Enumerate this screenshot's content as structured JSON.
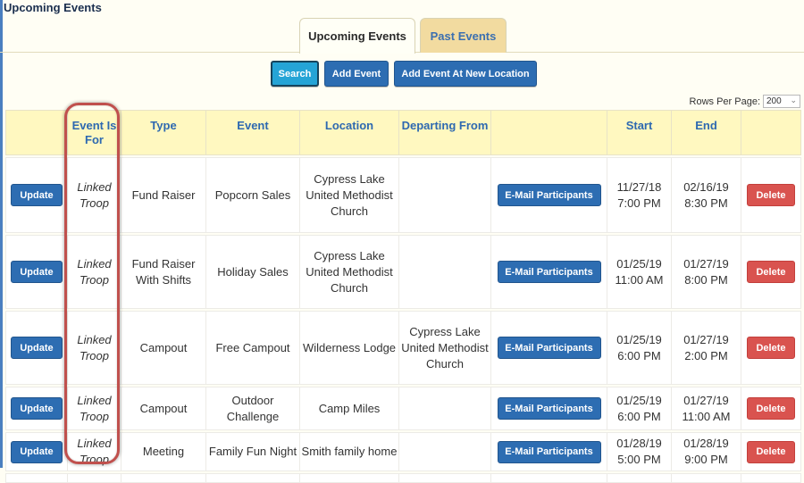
{
  "page": {
    "title": "Upcoming Events"
  },
  "tabs": [
    {
      "label": "Upcoming Events",
      "active": true
    },
    {
      "label": "Past Events",
      "active": false
    }
  ],
  "toolbar": {
    "search_label": "Search",
    "add_event_label": "Add Event",
    "add_event_new_location_label": "Add Event At New Location"
  },
  "rows_per_page": {
    "label": "Rows Per Page:",
    "value": "200"
  },
  "table": {
    "headers": [
      "",
      "Event Is For",
      "Type",
      "Event",
      "Location",
      "Departing From",
      "",
      "Start",
      "End",
      ""
    ],
    "rows": [
      {
        "update": "Update",
        "event_is_for": "Linked Troop",
        "type": "Fund Raiser",
        "event": "Popcorn Sales",
        "location": "Cypress Lake United Methodist Church",
        "departing_from": "",
        "email": "E-Mail Participants",
        "start_date": "11/27/18",
        "start_time": "7:00 PM",
        "end_date": "02/16/19",
        "end_time": "8:30 PM",
        "delete": "Delete"
      },
      {
        "update": "Update",
        "event_is_for": "Linked Troop",
        "type": "Fund Raiser With Shifts",
        "event": "Holiday Sales",
        "location": "Cypress Lake United Methodist Church",
        "departing_from": "",
        "email": "E-Mail Participants",
        "start_date": "01/25/19",
        "start_time": "11:00 AM",
        "end_date": "01/27/19",
        "end_time": "8:00 PM",
        "delete": "Delete"
      },
      {
        "update": "Update",
        "event_is_for": "Linked Troop",
        "type": "Campout",
        "event": "Free Campout",
        "location": "Wilderness Lodge",
        "departing_from": "Cypress Lake United Methodist Church",
        "email": "E-Mail Participants",
        "start_date": "01/25/19",
        "start_time": "6:00 PM",
        "end_date": "01/27/19",
        "end_time": "2:00 PM",
        "delete": "Delete"
      },
      {
        "update": "Update",
        "event_is_for": "Linked Troop",
        "type": "Campout",
        "event": "Outdoor Challenge",
        "location": "Camp Miles",
        "departing_from": "",
        "email": "E-Mail Participants",
        "start_date": "01/25/19",
        "start_time": "6:00 PM",
        "end_date": "01/27/19",
        "end_time": "11:00 AM",
        "delete": "Delete"
      },
      {
        "update": "Update",
        "event_is_for": "Linked Troop",
        "type": "Meeting",
        "event": "Family Fun Night",
        "location": "Smith family home",
        "departing_from": "",
        "email": "E-Mail Participants",
        "start_date": "01/28/19",
        "start_time": "5:00 PM",
        "end_date": "01/28/19",
        "end_time": "9:00 PM",
        "delete": "Delete"
      }
    ]
  },
  "colors": {
    "primary_button": "#2d6db2",
    "search_button": "#25a4d6",
    "delete_button": "#d9534f",
    "header_bg": "#fff8c0",
    "highlight": "#c0504d"
  }
}
